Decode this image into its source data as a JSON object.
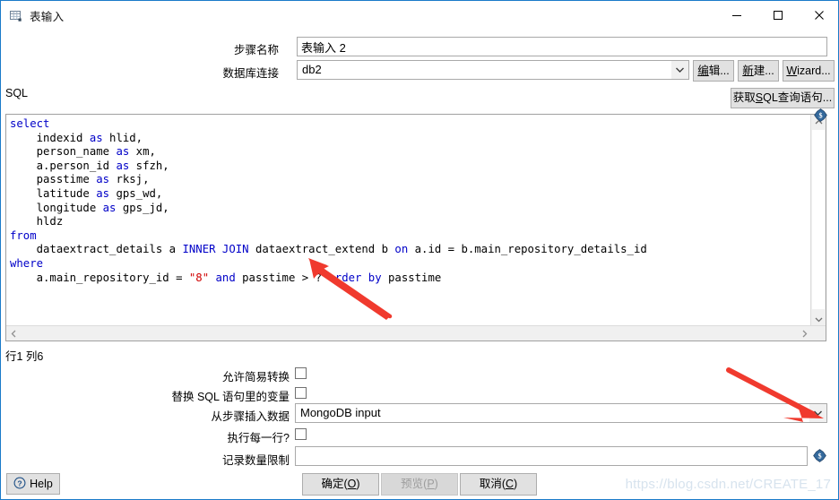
{
  "window": {
    "title": "表输入",
    "icon": "table-input-icon",
    "accent_color": "#1a7ac9",
    "controls": {
      "minimize": "minimize-icon",
      "maximize": "maximize-icon",
      "close": "close-icon"
    }
  },
  "form": {
    "step_name": {
      "label": "步骤名称",
      "value": "表输入 2",
      "placeholder": ""
    },
    "db_connection": {
      "label": "数据库连接",
      "value": "db2",
      "options": [
        "db2"
      ]
    },
    "buttons": {
      "edit": {
        "label": "编辑...",
        "mnemonic": "编"
      },
      "new": {
        "label": "新建...",
        "mnemonic": "新"
      },
      "wizard": {
        "label": "Wizard...",
        "mnemonic": "W"
      },
      "get_sql": {
        "label": "获取SQL查询语句...",
        "mnemonic": "S"
      }
    }
  },
  "sql": {
    "section_label": "SQL",
    "status": "行1 列6",
    "keyword_color": "#0000c8",
    "string_color": "#d00000",
    "lines": [
      [
        {
          "t": "select",
          "c": "kw"
        }
      ],
      [
        {
          "t": "    indexid ",
          "c": ""
        },
        {
          "t": "as",
          "c": "kw"
        },
        {
          "t": " hlid,",
          "c": ""
        }
      ],
      [
        {
          "t": "    person_name ",
          "c": ""
        },
        {
          "t": "as",
          "c": "kw"
        },
        {
          "t": " xm,",
          "c": ""
        }
      ],
      [
        {
          "t": "    a.person_id ",
          "c": ""
        },
        {
          "t": "as",
          "c": "kw"
        },
        {
          "t": " sfzh,",
          "c": ""
        }
      ],
      [
        {
          "t": "    passtime ",
          "c": ""
        },
        {
          "t": "as",
          "c": "kw"
        },
        {
          "t": " rksj,",
          "c": ""
        }
      ],
      [
        {
          "t": "    latitude ",
          "c": ""
        },
        {
          "t": "as",
          "c": "kw"
        },
        {
          "t": " gps_wd,",
          "c": ""
        }
      ],
      [
        {
          "t": "    longitude ",
          "c": ""
        },
        {
          "t": "as",
          "c": "kw"
        },
        {
          "t": " gps_jd,",
          "c": ""
        }
      ],
      [
        {
          "t": "    hldz",
          "c": ""
        }
      ],
      [
        {
          "t": "from",
          "c": "kw"
        }
      ],
      [
        {
          "t": "    dataextract_details a ",
          "c": ""
        },
        {
          "t": "INNER JOIN",
          "c": "kw"
        },
        {
          "t": " dataextract_extend b ",
          "c": ""
        },
        {
          "t": "on",
          "c": "kw"
        },
        {
          "t": " a.id = b.main_repository_details_id",
          "c": ""
        }
      ],
      [
        {
          "t": "where",
          "c": "kw"
        }
      ],
      [
        {
          "t": "    a.main_repository_id = ",
          "c": ""
        },
        {
          "t": "\"8\"",
          "c": "str"
        },
        {
          "t": " ",
          "c": ""
        },
        {
          "t": "and",
          "c": "kw"
        },
        {
          "t": " passtime > ? ",
          "c": ""
        },
        {
          "t": "order by",
          "c": "kw"
        },
        {
          "t": " passtime",
          "c": ""
        }
      ]
    ]
  },
  "options": {
    "allow_simple_transform": {
      "label": "允许简易转换",
      "checked": false
    },
    "replace_variables": {
      "label": "替换 SQL 语句里的变量",
      "checked": false
    },
    "insert_data_from_step": {
      "label": "从步骤插入数据",
      "value": "MongoDB input",
      "options": [
        "MongoDB input"
      ]
    },
    "execute_for_each_row": {
      "label": "执行每一行?",
      "checked": false
    },
    "row_limit": {
      "label": "记录数量限制",
      "value": "",
      "placeholder": ""
    }
  },
  "footer": {
    "help": {
      "label": "Help",
      "icon": "help-circle-icon"
    },
    "ok": {
      "label": "确定(O)",
      "mnemonic": "O",
      "enabled": true
    },
    "preview": {
      "label": "预览(P)",
      "mnemonic": "P",
      "enabled": false
    },
    "cancel": {
      "label": "取消(C)",
      "mnemonic": "C",
      "enabled": true
    }
  },
  "annotations": {
    "arrow_color": "#f03a2e",
    "arrow_sql_target": "指向 SQL 中的 ? 参数占位符",
    "arrow_step_target": "指向 从步骤插入数据 下拉框"
  },
  "watermark": "https://blog.csdn.net/CREATE_17"
}
